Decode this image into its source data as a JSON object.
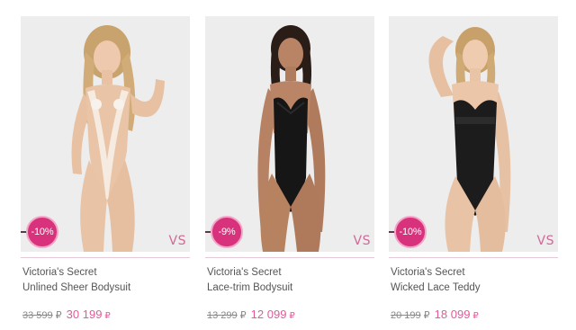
{
  "currency_symbol": "₽",
  "accent_color": "#d7327b",
  "price_color": "#e05b99",
  "products": [
    {
      "brand": "Victoria's Secret",
      "name": "Unlined Sheer Bodysuit",
      "discount": "10%",
      "old_price": "33 599",
      "new_price": "30 199",
      "logo": "VS",
      "garment_color": "#f3ece6"
    },
    {
      "brand": "Victoria's Secret",
      "name": "Lace-trim Bodysuit",
      "discount": "9%",
      "old_price": "13 299",
      "new_price": "12 099",
      "logo": "VS",
      "garment_color": "#161616"
    },
    {
      "brand": "Victoria's Secret",
      "name": "Wicked Lace Teddy",
      "discount": "10%",
      "old_price": "20 199",
      "new_price": "18 099",
      "logo": "VS",
      "garment_color": "#1c1c1c"
    }
  ]
}
